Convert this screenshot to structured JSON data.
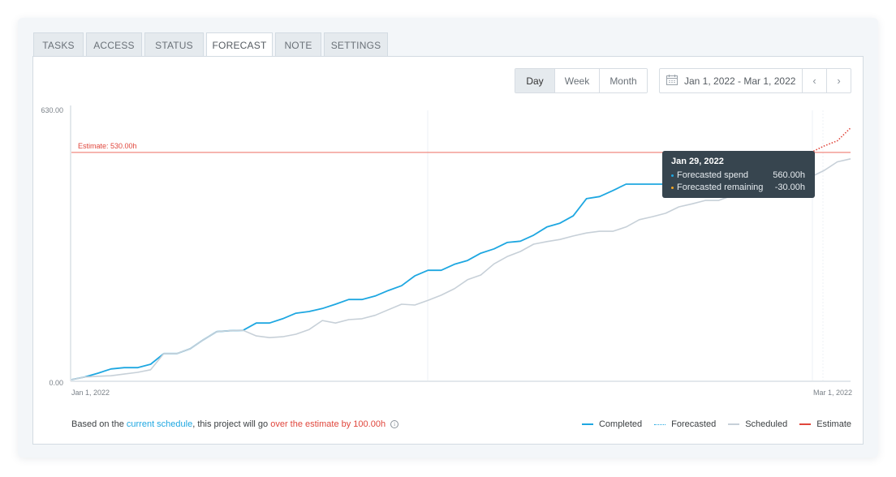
{
  "tabs": [
    {
      "label": "TASKS",
      "active": false
    },
    {
      "label": "ACCESS",
      "active": false
    },
    {
      "label": "STATUS",
      "active": false
    },
    {
      "label": "FORECAST",
      "active": true
    },
    {
      "label": "NOTE",
      "active": false
    },
    {
      "label": "SETTINGS",
      "active": false
    }
  ],
  "period_toggle": {
    "options": [
      "Day",
      "Week",
      "Month"
    ],
    "selected": "Day"
  },
  "date_range": {
    "icon": "calendar-icon",
    "value": "Jan 1, 2022 - Mar 1, 2022",
    "prev_icon": "chevron-left-icon",
    "prev_glyph": "‹",
    "next_icon": "chevron-right-icon",
    "next_glyph": "›"
  },
  "tooltip": {
    "title": "Jan 29, 2022",
    "rows": [
      {
        "label": "Forecasted spend",
        "value": "560.00h",
        "color": "#1ea7e1"
      },
      {
        "label": "Forecasted remaining",
        "value": "-30.00h",
        "color": "#f5a623"
      }
    ]
  },
  "footer": {
    "prefix": "Based on the ",
    "link": "current schedule",
    "middle": ", this project will go ",
    "warning": "over the estimate by 100.00h",
    "info_glyph": "i"
  },
  "colors": {
    "completed": "#1ea7e1",
    "forecasted": "#1ea7e1",
    "scheduled": "#c7d0d8",
    "estimate": "#f08a80",
    "forecast_over": "#e0463c"
  },
  "chart_data": {
    "type": "line",
    "title": "",
    "xlabel": "",
    "ylabel": "",
    "x_tick_labels": [
      "Jan 1, 2022",
      "Mar 1, 2022"
    ],
    "y_tick_labels": [
      "0.00",
      "630.00"
    ],
    "ylim": [
      0,
      630
    ],
    "x_range_days": [
      0,
      59
    ],
    "grid": false,
    "legend": {
      "position": "bottom-right",
      "entries": [
        {
          "name": "Completed",
          "style": "solid",
          "color": "#1ea7e1"
        },
        {
          "name": "Forecasted",
          "style": "dotted",
          "color": "#1ea7e1"
        },
        {
          "name": "Scheduled",
          "style": "solid",
          "color": "#c7d0d8"
        },
        {
          "name": "Estimate",
          "style": "solid",
          "color": "#e0463c"
        }
      ]
    },
    "estimate": {
      "value": 530,
      "label": "Estimate: 530.00h"
    },
    "series": [
      {
        "name": "Completed",
        "x": [
          0,
          1,
          2,
          3,
          4,
          5,
          6,
          7,
          8,
          9,
          10,
          11,
          12,
          13,
          14,
          15,
          16,
          17,
          18,
          19,
          20,
          21,
          22,
          23,
          24,
          25,
          26,
          27,
          28,
          29,
          30,
          31,
          32,
          33,
          34,
          35,
          36,
          37,
          38,
          39,
          40,
          41,
          42,
          43,
          44,
          45,
          46,
          47,
          48,
          49,
          50,
          51,
          52,
          53,
          54,
          55,
          56
        ],
        "values": [
          0,
          6,
          15,
          25,
          28,
          28,
          36,
          61,
          61,
          72,
          93,
          112,
          114,
          115,
          132,
          132,
          142,
          155,
          159,
          166,
          176,
          187,
          187,
          195,
          208,
          219,
          242,
          255,
          255,
          269,
          278,
          295,
          305,
          320,
          323,
          337,
          356,
          365,
          382,
          422,
          427,
          441,
          456,
          456,
          456,
          456,
          456,
          456,
          460,
          470,
          480,
          490,
          500,
          510,
          518,
          525,
          530
        ]
      },
      {
        "name": "Scheduled",
        "x": [
          0,
          1,
          2,
          3,
          4,
          5,
          6,
          7,
          8,
          9,
          10,
          11,
          12,
          13,
          14,
          15,
          16,
          17,
          18,
          19,
          20,
          21,
          22,
          23,
          24,
          25,
          26,
          27,
          28,
          29,
          30,
          31,
          32,
          33,
          34,
          35,
          36,
          37,
          38,
          39,
          40,
          41,
          42,
          43,
          44,
          45,
          46,
          47,
          48,
          49,
          50,
          51,
          52,
          53,
          54,
          55,
          56,
          57,
          58,
          59
        ],
        "values": [
          0,
          6,
          8,
          9,
          13,
          17,
          23,
          61,
          61,
          72,
          93,
          112,
          114,
          115,
          102,
          98,
          100,
          106,
          117,
          138,
          132,
          140,
          142,
          150,
          163,
          176,
          174,
          185,
          197,
          212,
          233,
          244,
          270,
          287,
          299,
          316,
          322,
          327,
          335,
          342,
          346,
          346,
          356,
          373,
          380,
          388,
          403,
          410,
          418,
          418,
          429,
          440,
          445,
          450,
          460,
          468,
          473,
          488,
          508,
          515
        ]
      },
      {
        "name": "Forecasted",
        "style": "dotted",
        "x": [
          56,
          57,
          58,
          59
        ],
        "values": [
          530,
          545,
          557,
          587
        ]
      }
    ],
    "annotations": [
      {
        "type": "tooltip",
        "date": "Jan 29, 2022",
        "Forecasted spend": "560.00h",
        "Forecasted remaining": "-30.00h"
      }
    ]
  }
}
